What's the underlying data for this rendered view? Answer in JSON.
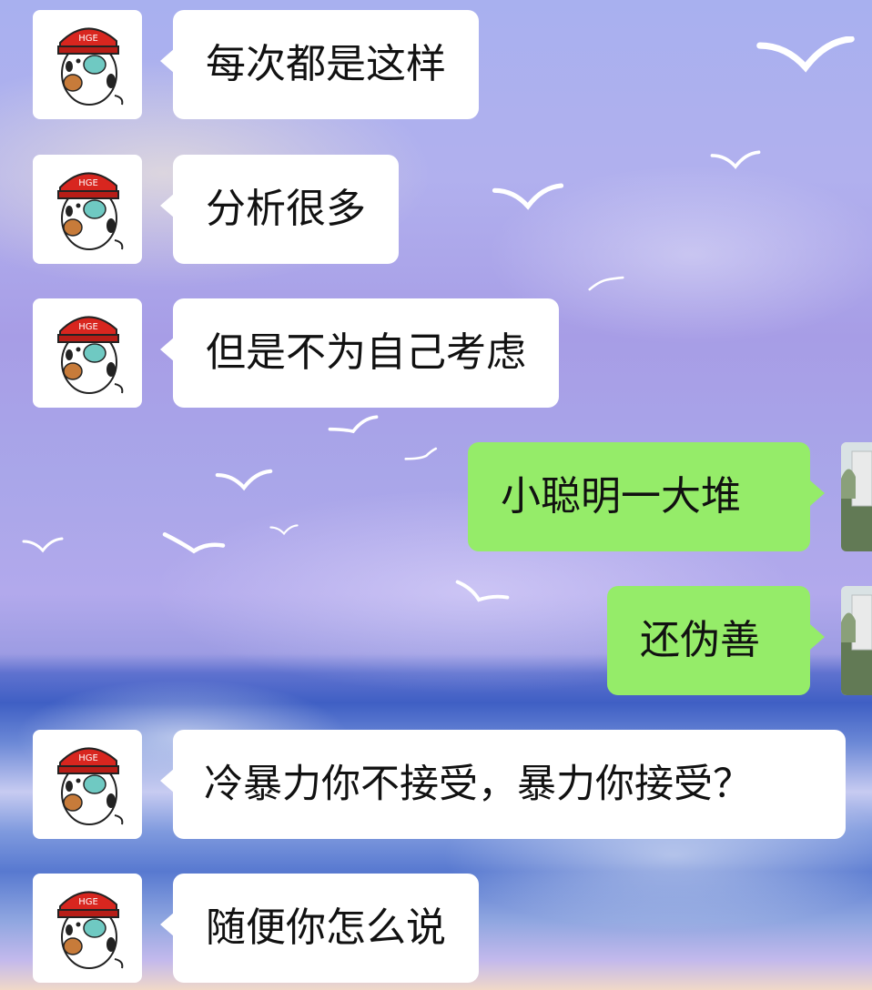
{
  "chat": {
    "messages": [
      {
        "side": "left",
        "text": "每次都是这样",
        "avatar": "cat-with-red-cap-avatar"
      },
      {
        "side": "left",
        "text": "分析很多",
        "avatar": "cat-with-red-cap-avatar"
      },
      {
        "side": "left",
        "text": "但是不为自己考虑",
        "avatar": "cat-with-red-cap-avatar"
      },
      {
        "side": "right",
        "text": "小聪明一大堆",
        "avatar": "landscape-photo-avatar"
      },
      {
        "side": "right",
        "text": "还伪善",
        "avatar": "landscape-photo-avatar"
      },
      {
        "side": "left",
        "text": "冷暴力你不接受，暴力你接受？",
        "avatar": "cat-with-red-cap-avatar"
      },
      {
        "side": "left",
        "text": "随便你怎么说",
        "avatar": "cat-with-red-cap-avatar"
      }
    ]
  },
  "colors": {
    "incoming_bubble": "#ffffff",
    "outgoing_bubble": "#95ec69",
    "text": "#111111"
  },
  "background": "painted-sky-with-seagulls-and-sea"
}
